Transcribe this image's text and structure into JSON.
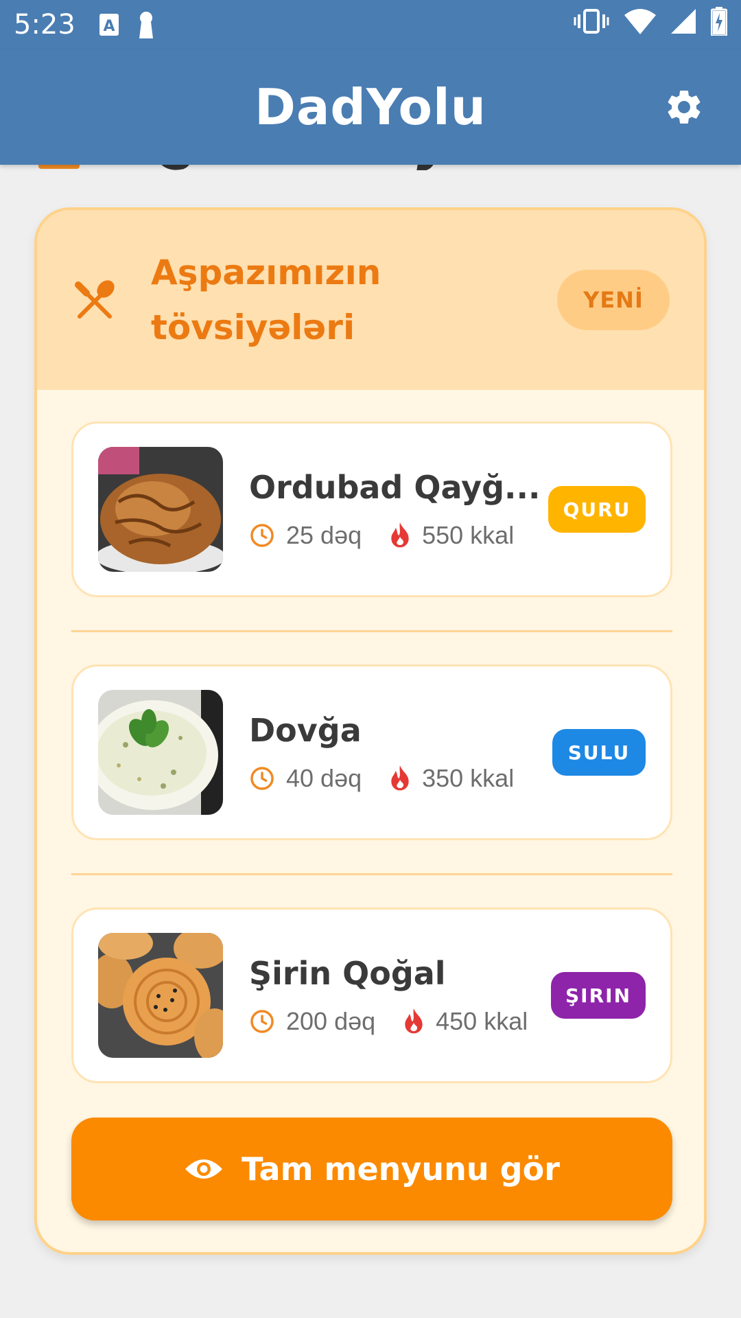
{
  "status_bar": {
    "time": "5:23",
    "icons": [
      "text-a-icon",
      "keyhole-icon",
      "vibrate-icon",
      "wifi-icon",
      "signal-icon",
      "battery-charging-icon"
    ]
  },
  "app_bar": {
    "title": "DadYolu",
    "settings_icon": "gear-icon"
  },
  "recommendations": {
    "heading": "Aşpazımızın tövsiyələri",
    "badge": "YENİ",
    "icon": "fork-spoon-icon",
    "items": [
      {
        "title": "Ordubad Qayğ...",
        "time": "25 dəq",
        "calories": "550 kkal",
        "tag": "QURU",
        "tag_color": "#ffb400"
      },
      {
        "title": "Dovğa",
        "time": "40 dəq",
        "calories": "350 kkal",
        "tag": "SULU",
        "tag_color": "#1e88e5"
      },
      {
        "title": "Şirin Qoğal",
        "time": "200 dəq",
        "calories": "450 kkal",
        "tag": "ŞIRIN",
        "tag_color": "#8e24aa"
      }
    ],
    "button_label": "Tam menyunu gör",
    "button_icon": "eye-icon"
  },
  "colors": {
    "app_bar": "#4a7db2",
    "accent": "#fb8a00",
    "heading": "#ec7a12"
  }
}
